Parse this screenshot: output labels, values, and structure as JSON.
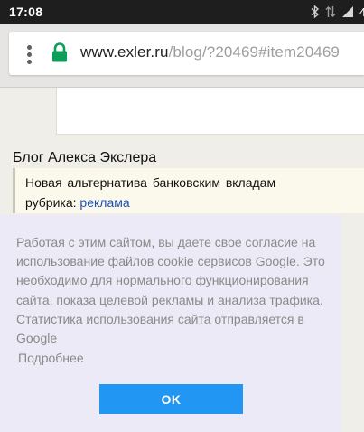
{
  "status_bar": {
    "time": "17:08",
    "network_label": "4"
  },
  "browser": {
    "url_host": "www.exler.ru",
    "url_path": "/blog/?20469#item20469"
  },
  "page": {
    "blog_title": "Блог Алекса Экслера",
    "post_title": "Новая альтернатива банковским вкладам",
    "rubric_label": "рубрика:",
    "rubric_link": "реклама"
  },
  "cookie_notice": {
    "text": "Работая с этим сайтом, вы даете свое согласие на использование файлов cookie сервисов Google. Это необходимо для нормального функционирования сайта, показа целевой рекламы и анализа трафика. Статистика использования сайта отправляется в Google",
    "more_link": "Подробнее",
    "ok_button": "OK"
  },
  "colors": {
    "status_bar_bg": "#1e1e1e",
    "lock_green": "#0f9d58",
    "accent_blue": "#2196f3",
    "link_blue": "#1a4fb8",
    "cookie_bg": "#eceaf6"
  }
}
